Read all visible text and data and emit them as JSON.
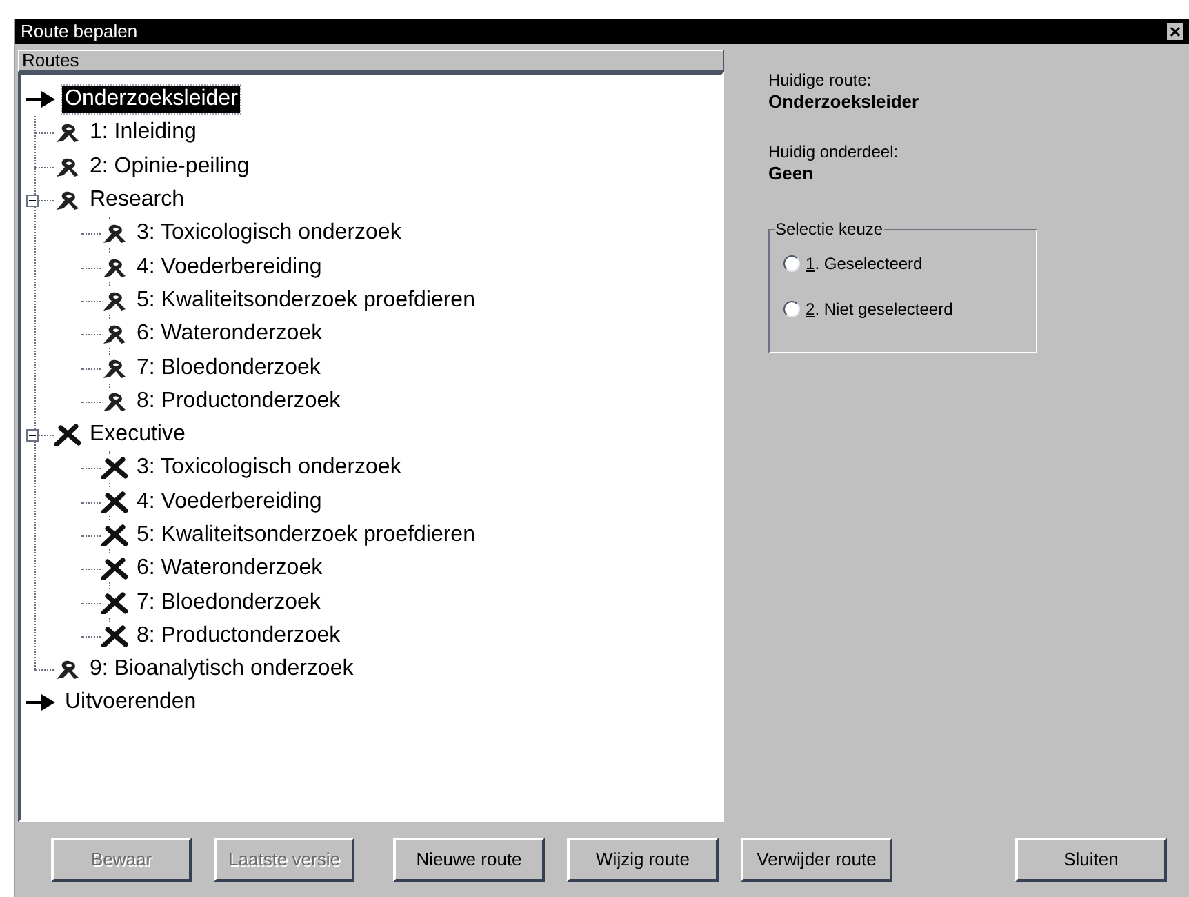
{
  "window": {
    "title": "Route bepalen"
  },
  "tree": {
    "header": "Routes",
    "items": [
      {
        "label": "Onderzoeksleider",
        "kind": "arrow",
        "selected": true,
        "children": [
          {
            "label": "1: Inleiding",
            "kind": "ribbon",
            "selected": false
          },
          {
            "label": "2: Opinie-peiling",
            "kind": "ribbon",
            "selected": false
          },
          {
            "label": "Research",
            "kind": "ribbon",
            "selected": false,
            "expanded": true,
            "children": [
              {
                "label": "3: Toxicologisch onderzoek",
                "kind": "ribbon",
                "selected": false
              },
              {
                "label": "4: Voederbereiding",
                "kind": "ribbon",
                "selected": false
              },
              {
                "label": "5: Kwaliteitsonderzoek proefdieren",
                "kind": "ribbon",
                "selected": false
              },
              {
                "label": "6: Wateronderzoek",
                "kind": "ribbon",
                "selected": false
              },
              {
                "label": "7: Bloedonderzoek",
                "kind": "ribbon",
                "selected": false
              },
              {
                "label": "8: Productonderzoek",
                "kind": "ribbon",
                "selected": false
              }
            ]
          },
          {
            "label": "Executive",
            "kind": "cross",
            "selected": false,
            "expanded": true,
            "children": [
              {
                "label": "3: Toxicologisch onderzoek",
                "kind": "cross",
                "selected": false
              },
              {
                "label": "4: Voederbereiding",
                "kind": "cross",
                "selected": false
              },
              {
                "label": "5: Kwaliteitsonderzoek proefdieren",
                "kind": "cross",
                "selected": false
              },
              {
                "label": "6: Wateronderzoek",
                "kind": "cross",
                "selected": false
              },
              {
                "label": "7: Bloedonderzoek",
                "kind": "cross",
                "selected": false
              },
              {
                "label": "8: Productonderzoek",
                "kind": "cross",
                "selected": false
              }
            ]
          },
          {
            "label": "9: Bioanalytisch onderzoek",
            "kind": "ribbon",
            "selected": false
          }
        ]
      },
      {
        "label": "Uitvoerenden",
        "kind": "arrow",
        "selected": false
      }
    ]
  },
  "info": [
    {
      "label": "Huidige route:",
      "value": "Onderzoeksleider"
    },
    {
      "label": "Huidig onderdeel:",
      "value": "Geen"
    }
  ],
  "selection_group": {
    "title": "Selectie keuze",
    "options": [
      {
        "accel": "1",
        "label": ". Geselecteerd",
        "selected": false
      },
      {
        "accel": "2",
        "label": ". Niet geselecteerd",
        "selected": false
      }
    ]
  },
  "buttons": [
    {
      "label": "Bewaar",
      "disabled": true
    },
    {
      "label": "Laatste versie",
      "disabled": true
    },
    {
      "label": "Nieuwe route",
      "disabled": false
    },
    {
      "label": "Wijzig route",
      "disabled": false
    },
    {
      "label": "Verwijder route",
      "disabled": false
    },
    {
      "label": "Sluiten",
      "disabled": false
    }
  ]
}
